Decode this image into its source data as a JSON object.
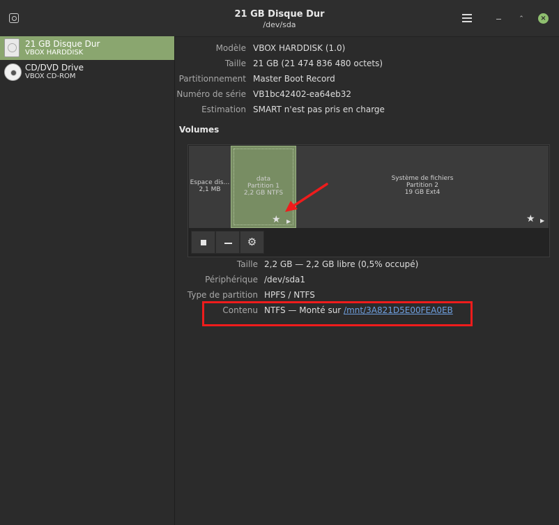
{
  "window": {
    "title": "21 GB Disque Dur",
    "subtitle": "/dev/sda",
    "close_glyph": "×",
    "maximize_glyph": "⌃"
  },
  "drives": [
    {
      "name": "21 GB Disque Dur",
      "model": "VBOX HARDDISK",
      "icon": "hard-disk-icon",
      "selected": true
    },
    {
      "name": "CD/DVD Drive",
      "model": "VBOX CD-ROM",
      "icon": "optical-disc-icon",
      "selected": false
    }
  ],
  "drive_properties": [
    {
      "label": "Modèle",
      "value": "VBOX HARDDISK (1.0)"
    },
    {
      "label": "Taille",
      "value": "21 GB (21 474 836 480 octets)"
    },
    {
      "label": "Partitionnement",
      "value": "Master Boot Record"
    },
    {
      "label": "Numéro de série",
      "value": "VB1bc42402-ea64eb32"
    },
    {
      "label": "Estimation",
      "value": "SMART n'est pas pris en charge"
    }
  ],
  "volumes_title": "Volumes",
  "volumes": [
    {
      "lines": [
        "Espace dis…",
        "2,1 MB"
      ],
      "selected": false
    },
    {
      "lines": [
        "data",
        "Partition 1",
        "2,2 GB NTFS"
      ],
      "selected": true
    },
    {
      "lines": [
        "Système de fichiers",
        "Partition 2",
        "19 GB Ext4"
      ],
      "selected": false
    }
  ],
  "volume_toolbar": {
    "gear_glyph": "⚙"
  },
  "volume_details": [
    {
      "label": "Taille",
      "value": "2,2 GB — 2,2 GB libre (0,5% occupé)"
    },
    {
      "label": "Périphérique",
      "value": "/dev/sda1"
    },
    {
      "label": "Type de partition",
      "value": "HPFS / NTFS"
    },
    {
      "label": "Contenu",
      "value": "NTFS — Monté sur ",
      "link": "/mnt/3A821D5E00FEA0EB"
    }
  ],
  "glyphs": {
    "star": "★",
    "play": "▶"
  },
  "colors": {
    "selection": "#8aa66f",
    "partition_selected": "#788d63",
    "annotation": "#ee1c1c",
    "link": "#6fa0e0"
  }
}
